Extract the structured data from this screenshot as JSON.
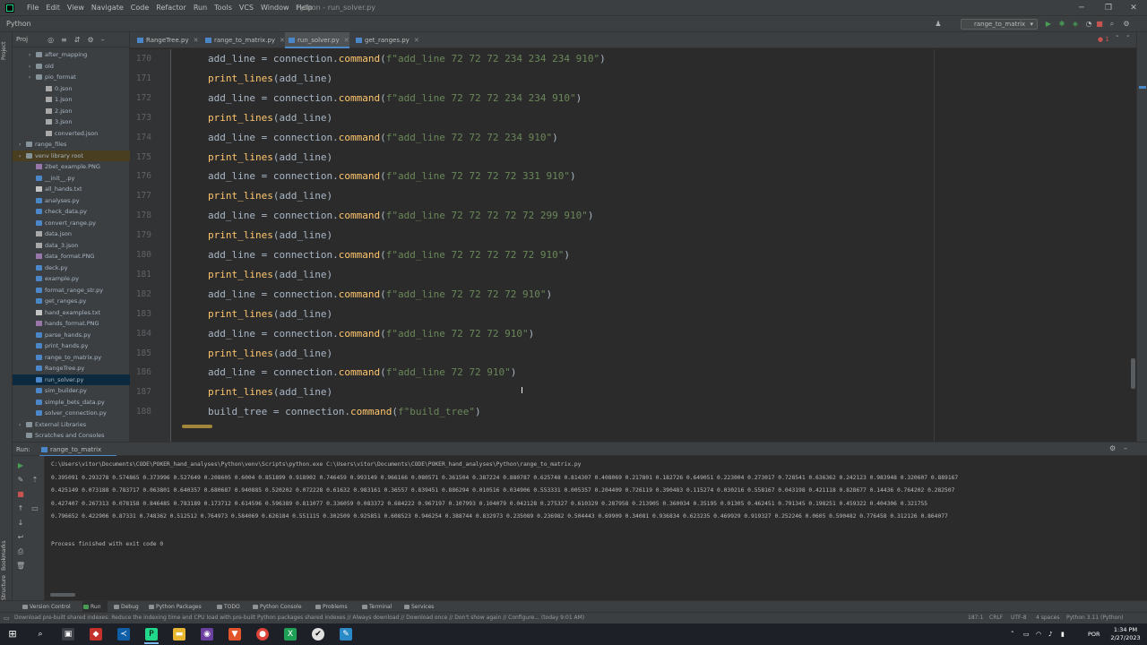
{
  "titlebar": {
    "menu": [
      "File",
      "Edit",
      "View",
      "Navigate",
      "Code",
      "Refactor",
      "Run",
      "Tools",
      "VCS",
      "Window",
      "Help"
    ],
    "window_title": "Python - run_solver.py",
    "minimize": "─",
    "maximize": "❐",
    "close": "✕"
  },
  "navbar": {
    "project_name": "Python",
    "run_config": "range_to_matrix",
    "run_config_icon": "run-config-icon"
  },
  "left_stripe": {
    "project": "Project",
    "bookmarks": "Bookmarks",
    "structure": "Structure"
  },
  "project_panel": {
    "header": "Proj",
    "tree": [
      {
        "label": "after_mapping",
        "type": "folder",
        "depth": 2,
        "arrow": "›"
      },
      {
        "label": "old",
        "type": "folder",
        "depth": 2,
        "arrow": "›"
      },
      {
        "label": "pio_format",
        "type": "folder",
        "depth": 2,
        "arrow": "›"
      },
      {
        "label": "0.json",
        "type": "json",
        "depth": 3,
        "arrow": ""
      },
      {
        "label": "1.json",
        "type": "json",
        "depth": 3,
        "arrow": ""
      },
      {
        "label": "2.json",
        "type": "json",
        "depth": 3,
        "arrow": ""
      },
      {
        "label": "3.json",
        "type": "json",
        "depth": 3,
        "arrow": ""
      },
      {
        "label": "converted.json",
        "type": "json",
        "depth": 3,
        "arrow": ""
      },
      {
        "label": "range_files",
        "type": "folder",
        "depth": 1,
        "arrow": "›"
      },
      {
        "label": "venv  library root",
        "type": "folder",
        "depth": 1,
        "arrow": "›"
      },
      {
        "label": "2bet_example.PNG",
        "type": "img",
        "depth": 2,
        "arrow": ""
      },
      {
        "label": "__init__.py",
        "type": "py",
        "depth": 2,
        "arrow": ""
      },
      {
        "label": "all_hands.txt",
        "type": "txt",
        "depth": 2,
        "arrow": ""
      },
      {
        "label": "analyses.py",
        "type": "py",
        "depth": 2,
        "arrow": ""
      },
      {
        "label": "check_data.py",
        "type": "py",
        "depth": 2,
        "arrow": ""
      },
      {
        "label": "convert_range.py",
        "type": "py",
        "depth": 2,
        "arrow": ""
      },
      {
        "label": "data.json",
        "type": "json",
        "depth": 2,
        "arrow": ""
      },
      {
        "label": "data_3.json",
        "type": "json",
        "depth": 2,
        "arrow": ""
      },
      {
        "label": "data_format.PNG",
        "type": "img",
        "depth": 2,
        "arrow": ""
      },
      {
        "label": "deck.py",
        "type": "py",
        "depth": 2,
        "arrow": ""
      },
      {
        "label": "example.py",
        "type": "py",
        "depth": 2,
        "arrow": ""
      },
      {
        "label": "format_range_str.py",
        "type": "py",
        "depth": 2,
        "arrow": ""
      },
      {
        "label": "get_ranges.py",
        "type": "py",
        "depth": 2,
        "arrow": ""
      },
      {
        "label": "hand_examples.txt",
        "type": "txt",
        "depth": 2,
        "arrow": ""
      },
      {
        "label": "hands_format.PNG",
        "type": "img",
        "depth": 2,
        "arrow": ""
      },
      {
        "label": "parse_hands.py",
        "type": "py",
        "depth": 2,
        "arrow": ""
      },
      {
        "label": "print_hands.py",
        "type": "py",
        "depth": 2,
        "arrow": ""
      },
      {
        "label": "range_to_matrix.py",
        "type": "py",
        "depth": 2,
        "arrow": ""
      },
      {
        "label": "RangeTree.py",
        "type": "py",
        "depth": 2,
        "arrow": ""
      },
      {
        "label": "run_solver.py",
        "type": "py",
        "depth": 2,
        "arrow": "",
        "selected": true
      },
      {
        "label": "sim_builder.py",
        "type": "py",
        "depth": 2,
        "arrow": ""
      },
      {
        "label": "simple_bets_data.py",
        "type": "py",
        "depth": 2,
        "arrow": ""
      },
      {
        "label": "solver_connection.py",
        "type": "py",
        "depth": 2,
        "arrow": ""
      },
      {
        "label": "External Libraries",
        "type": "folder",
        "depth": 1,
        "arrow": "›"
      },
      {
        "label": "Scratches and Consoles",
        "type": "folder",
        "depth": 1,
        "arrow": ""
      }
    ]
  },
  "tabs": [
    {
      "label": "RangeTree.py",
      "active": false
    },
    {
      "label": "range_to_matrix.py",
      "active": false
    },
    {
      "label": "run_solver.py",
      "active": true
    },
    {
      "label": "get_ranges.py",
      "active": false
    }
  ],
  "editor": {
    "lines": [
      {
        "n": "170",
        "kind": "assign",
        "var": "add_line",
        "str": "f\"add_line 72 72 72 234 234 234 910\""
      },
      {
        "n": "171",
        "kind": "print",
        "arg": "add_line"
      },
      {
        "n": "172",
        "kind": "assign",
        "var": "add_line",
        "str": "f\"add_line 72 72 72 234 234 910\""
      },
      {
        "n": "173",
        "kind": "print",
        "arg": "add_line"
      },
      {
        "n": "174",
        "kind": "assign",
        "var": "add_line",
        "str": "f\"add_line 72 72 72 234 910\""
      },
      {
        "n": "175",
        "kind": "print",
        "arg": "add_line"
      },
      {
        "n": "176",
        "kind": "assign",
        "var": "add_line",
        "str": "f\"add_line 72 72 72 72 331 910\""
      },
      {
        "n": "177",
        "kind": "print",
        "arg": "add_line"
      },
      {
        "n": "178",
        "kind": "assign",
        "var": "add_line",
        "str": "f\"add_line 72 72 72 72 72 299 910\""
      },
      {
        "n": "179",
        "kind": "print",
        "arg": "add_line"
      },
      {
        "n": "180",
        "kind": "assign",
        "var": "add_line",
        "str": "f\"add_line 72 72 72 72 72 910\""
      },
      {
        "n": "181",
        "kind": "print",
        "arg": "add_line"
      },
      {
        "n": "182",
        "kind": "assign",
        "var": "add_line",
        "str": "f\"add_line 72 72 72 72 910\""
      },
      {
        "n": "183",
        "kind": "print",
        "arg": "add_line"
      },
      {
        "n": "184",
        "kind": "assign",
        "var": "add_line",
        "str": "f\"add_line 72 72 72 910\""
      },
      {
        "n": "185",
        "kind": "print",
        "arg": "add_line"
      },
      {
        "n": "186",
        "kind": "assign",
        "var": "add_line",
        "str": "f\"add_line 72 72 910\""
      },
      {
        "n": "187",
        "kind": "print",
        "arg": "add_line"
      },
      {
        "n": "188",
        "kind": "assign",
        "var": "build_tree",
        "str": "f\"build_tree\""
      }
    ],
    "object": "connection",
    "method": "command",
    "print_fn": "print_lines"
  },
  "run_panel": {
    "label": "Run:",
    "tab": "range_to_matrix",
    "command": "C:\\Users\\vitor\\Documents\\CODE\\POKER_hand_analyses\\Python\\venv\\Scripts\\python.exe C:\\Users\\vitor\\Documents\\CODE\\POKER_hand_analyses\\Python\\range_to_matrix.py",
    "output": [
      "0.395091 0.293278 0.574865 0.373996 0.527649 0.208605 0.6004 0.851899 0.918902 0.746459 0.993149 0.966166 0.080571 0.361504 0.387224 0.880787 0.625748 0.814307 0.408069 0.217801 0.182726 0.649051 0.223004 0.273017 0.728541 0.636362 0.242123 0.983948 0.320607 0.889167",
      "0.425149 0.073188 0.783717 0.063801 0.640357 0.680687 0.940885 0.520202 0.072228 0.61632 0.983161 0.36557 0.839451 0.886294 0.010516 0.034906 0.553331 0.005357 0.204409 0.726119 0.390483 0.115274 0.030216 0.558167 0.043198 0.421118 0.828677 0.14436 0.764202 0.282507",
      "0.427407 0.267313 0.078158 0.846485 0.783189 0.173712 0.614596 0.596389 0.811077 0.336059 0.083372 0.684222 0.967197 0.107993 0.104079 0.042128 0.275327 0.610329 0.287958 0.213905 0.360034 0.35195 0.01305 0.462451 0.791345 0.198251 0.459322 0.404306 0.321755",
      "0.796652 0.422906 0.87331 0.748362 0.512512 0.764973 0.584069 0.626184 0.551115 0.302509 0.925851 0.608523 0.946254 0.388744 0.832973 0.235089 0.236982 0.504443 0.69909 0.34081 0.936834 0.623235 0.469929 0.919327 0.252246 0.0605 0.590482 0.776458 0.312126 0.864077"
    ],
    "exit": "Process finished with exit code 0"
  },
  "bottom_tabs": [
    {
      "label": "Version Control",
      "active": false
    },
    {
      "label": "Run",
      "active": true
    },
    {
      "label": "Debug",
      "active": false
    },
    {
      "label": "Python Packages",
      "active": false
    },
    {
      "label": "TODO",
      "active": false
    },
    {
      "label": "Python Console",
      "active": false
    },
    {
      "label": "Problems",
      "active": false
    },
    {
      "label": "Terminal",
      "active": false
    },
    {
      "label": "Services",
      "active": false
    }
  ],
  "statusbar": {
    "message": "Download pre-built shared indexes: Reduce the indexing time and CPU load with pre-built Python packages shared indexes // Always download // Download once // Don't show again // Configure... (today 9:01 AM)",
    "position": "187:1",
    "line_sep": "CRLF",
    "encoding": "UTF-8",
    "indent": "4 spaces",
    "interpreter": "Python 3.11 (Python)"
  },
  "taskbar": {
    "lang": "POR",
    "time": "1:34 PM",
    "date": "2/27/2023"
  }
}
